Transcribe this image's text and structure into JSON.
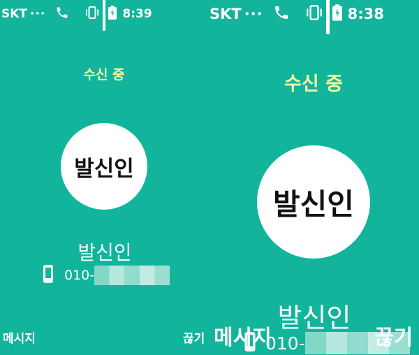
{
  "left": {
    "status": {
      "carrier": "SKT",
      "dots": "···",
      "time": "8:39"
    },
    "incoming_label": "수신 중",
    "avatar_text": "발신인",
    "caller_name": "발신인",
    "number_prefix": "010-",
    "softkey_left": "메시지",
    "softkey_right": "끊기"
  },
  "right": {
    "status": {
      "carrier": "SKT",
      "dots": "···",
      "time": "8:38"
    },
    "incoming_label": "수신 중",
    "avatar_text": "발신인",
    "caller_name": "발신인",
    "number_prefix": "010-",
    "softkey_left": "메시지",
    "softkey_right": "끊기"
  },
  "colors": {
    "background": "#12b49c",
    "incoming": "#f5f5a0"
  },
  "icons": [
    "phone-icon",
    "vibrate-icon",
    "signal-icon",
    "battery-icon",
    "mobile-icon"
  ]
}
